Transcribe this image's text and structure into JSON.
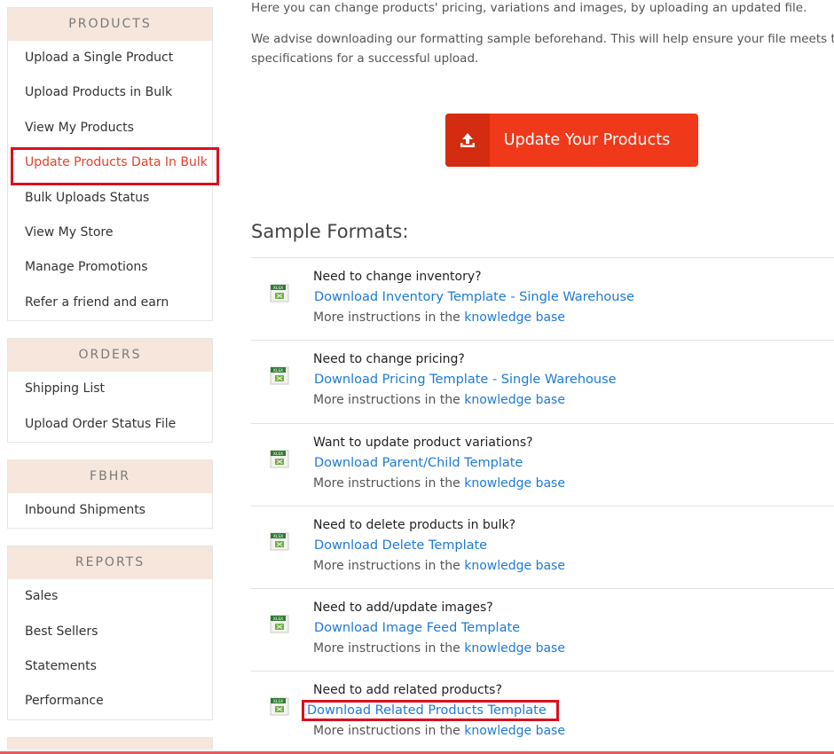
{
  "sidebar": {
    "sections": [
      {
        "title": "PRODUCTS",
        "items": [
          {
            "label": "Upload a Single Product"
          },
          {
            "label": "Upload Products in Bulk"
          },
          {
            "label": "View My Products"
          },
          {
            "label": "Update Products Data In Bulk"
          },
          {
            "label": "Bulk Uploads Status"
          },
          {
            "label": "View My Store"
          },
          {
            "label": "Manage Promotions"
          },
          {
            "label": "Refer a friend and earn"
          }
        ]
      },
      {
        "title": "ORDERS",
        "items": [
          {
            "label": "Shipping List"
          },
          {
            "label": "Upload Order Status File"
          }
        ]
      },
      {
        "title": "FBHR",
        "items": [
          {
            "label": "Inbound Shipments"
          }
        ]
      },
      {
        "title": "REPORTS",
        "items": [
          {
            "label": "Sales"
          },
          {
            "label": "Best Sellers"
          },
          {
            "label": "Statements"
          },
          {
            "label": "Performance"
          }
        ]
      }
    ]
  },
  "main": {
    "intro_line1": "Here you can change products' pricing, variations and images, by uploading an updated file.",
    "intro_line2": "We advise downloading our formatting sample beforehand. This will help ensure your file meets the specifications for a successful upload.",
    "update_button": "Update Your Products",
    "sample_formats_title": "Sample Formats:",
    "file_icon_text": "XLSX",
    "rows": [
      {
        "question": "Need to change inventory?",
        "download": "Download Inventory Template - Single Warehouse",
        "more": "More instructions in the",
        "kb": "knowledge base"
      },
      {
        "question": "Need to change pricing?",
        "download": "Download Pricing Template - Single Warehouse",
        "more": "More instructions in the",
        "kb": "knowledge base"
      },
      {
        "question": "Want to update product variations?",
        "download": "Download Parent/Child Template",
        "more": "More instructions in the",
        "kb": "knowledge base"
      },
      {
        "question": "Need to delete products in bulk?",
        "download": "Download Delete Template",
        "more": "More instructions in the",
        "kb": "knowledge base"
      },
      {
        "question": "Need to add/update images?",
        "download": "Download Image Feed Template",
        "more": "More instructions in the",
        "kb": "knowledge base"
      },
      {
        "question": "Need to add related products?",
        "download": "Download Related Products Template",
        "more": "More instructions in the",
        "kb": "knowledge base"
      }
    ]
  },
  "colors": {
    "accent": "#f0391a",
    "link": "#1e7ad6",
    "section_header_bg": "#f6e6dc",
    "highlight_box": "#d9101e"
  }
}
